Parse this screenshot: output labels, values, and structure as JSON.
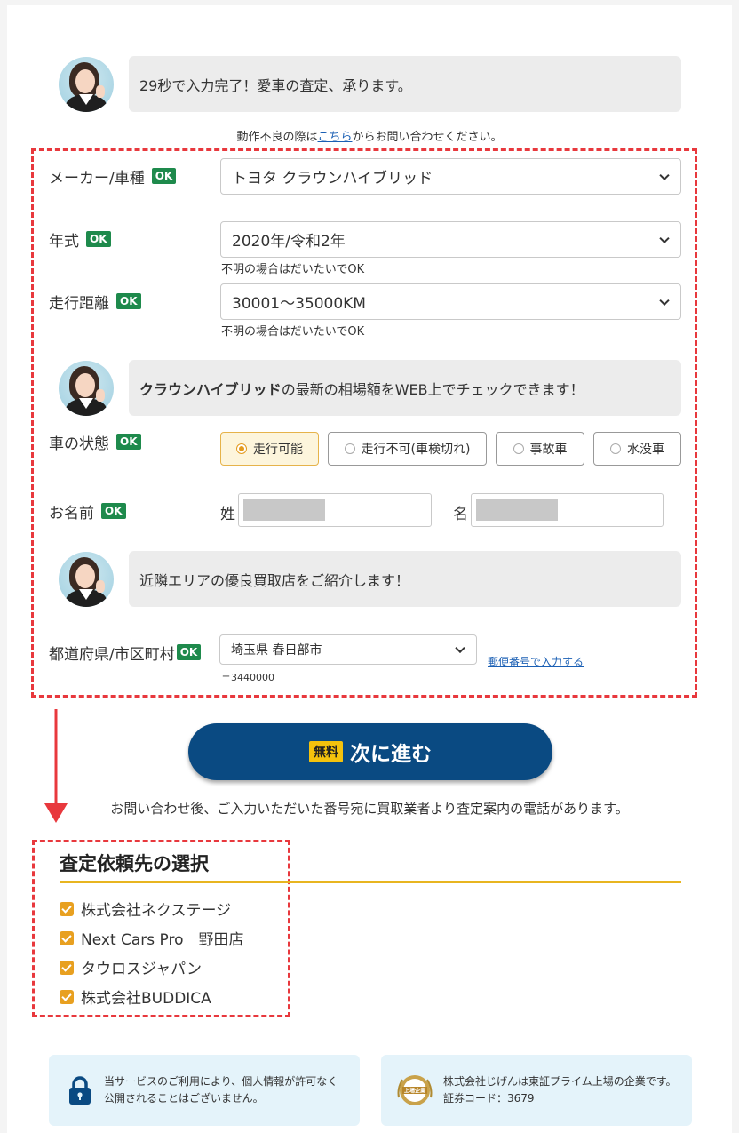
{
  "intro": {
    "speech": "29秒で入力完了！愛車の査定、承ります。",
    "trouble_prefix": "動作不良の際は",
    "trouble_link": "こちら",
    "trouble_suffix": "からお問い合わせください。"
  },
  "ok_badge": "OK",
  "form": {
    "maker": {
      "label": "メーカー/車種",
      "value": "トヨタ クラウンハイブリッド"
    },
    "year": {
      "label": "年式",
      "value": "2020年/令和2年",
      "note": "不明の場合はだいたいでOK"
    },
    "mileage": {
      "label": "走行距離",
      "value": "30001～35000KM",
      "note": "不明の場合はだいたいでOK"
    },
    "speech2_bold": "クラウンハイブリッド",
    "speech2_rest": "の最新の相場額をWEB上でチェックできます！",
    "condition": {
      "label": "車の状態",
      "options": [
        "走行可能",
        "走行不可(車検切れ)",
        "事故車",
        "水没車"
      ],
      "selected": "走行可能"
    },
    "name": {
      "label": "お名前",
      "last_label": "姓",
      "first_label": "名"
    },
    "speech3": "近隣エリアの優良買取店をご紹介します！",
    "area": {
      "label": "都道府県/市区町村",
      "value": "埼玉県 春日部市",
      "zip": "〒3440000",
      "postal_link": "郵便番号で入力する"
    }
  },
  "cta": {
    "free": "無料",
    "label": "次に進む"
  },
  "notice": "お問い合わせ後、ご入力いただいた番号宛に買取業者より査定案内の電話があります。",
  "selection": {
    "title": "査定依頼先の選択",
    "accent": "#e8b520",
    "companies": [
      "株式会社ネクステージ",
      "Next Cars Pro　野田店",
      "タウロスジャパン",
      "株式会社BUDDICA"
    ]
  },
  "footer": {
    "privacy_line1": "当サービスのご利用により、個人情報が許可なく",
    "privacy_line2": "公開されることはございません。",
    "listed_line1": "株式会社じげんは東証プライム上場の企業です。",
    "listed_line2": "証券コード：3679",
    "badge_text": "上場企業"
  }
}
